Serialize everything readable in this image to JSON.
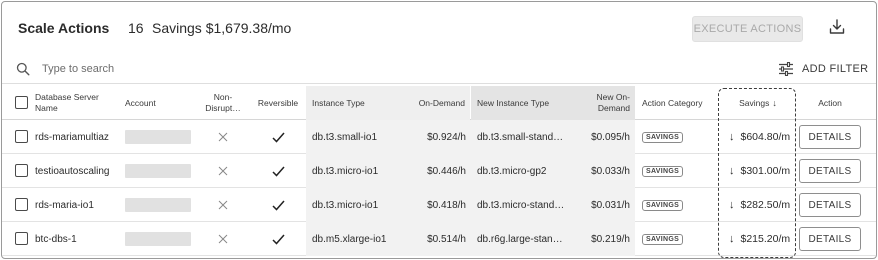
{
  "header": {
    "title": "Scale Actions",
    "count": "16",
    "savings": "Savings  $1,679.38/mo",
    "execute_label": "EXECUTE ACTIONS",
    "download_icon": "download-icon"
  },
  "search": {
    "placeholder": "Type to search",
    "filter_label": "ADD FILTER"
  },
  "columns": {
    "name": "Database Server Name",
    "account": "Account",
    "non_disruptive": "Non-Disrupt…",
    "reversible": "Reversible",
    "instance_type": "Instance Type",
    "on_demand": "On-Demand",
    "new_instance_type": "New Instance Type",
    "new_on_demand": "New On-Demand",
    "action_category": "Action Category",
    "savings": "Savings",
    "action": "Action"
  },
  "rows": [
    {
      "name": "rds-mariamultiaz",
      "instance_type": "db.t3.small-io1",
      "on_demand": "$0.924/h",
      "new_instance_type": "db.t3.small-stand…",
      "new_on_demand": "$0.095/h",
      "category": "SAVINGS",
      "savings": "$604.80/m",
      "action": "DETAILS"
    },
    {
      "name": "testioautoscaling",
      "instance_type": "db.t3.micro-io1",
      "on_demand": "$0.446/h",
      "new_instance_type": "db.t3.micro-gp2",
      "new_on_demand": "$0.033/h",
      "category": "SAVINGS",
      "savings": "$301.00/m",
      "action": "DETAILS"
    },
    {
      "name": "rds-maria-io1",
      "instance_type": "db.t3.micro-io1",
      "on_demand": "$0.418/h",
      "new_instance_type": "db.t3.micro-stand…",
      "new_on_demand": "$0.031/h",
      "category": "SAVINGS",
      "savings": "$282.50/m",
      "action": "DETAILS"
    },
    {
      "name": "btc-dbs-1",
      "instance_type": "db.m5.xlarge-io1",
      "on_demand": "$0.514/h",
      "new_instance_type": "db.r6g.large-stan…",
      "new_on_demand": "$0.219/h",
      "category": "SAVINGS",
      "savings": "$215.20/m",
      "action": "DETAILS"
    }
  ],
  "colors": {
    "header_grey": "#efefef",
    "cell_grey": "#f2f2f2",
    "button_disabled": "#e9e9e9"
  }
}
